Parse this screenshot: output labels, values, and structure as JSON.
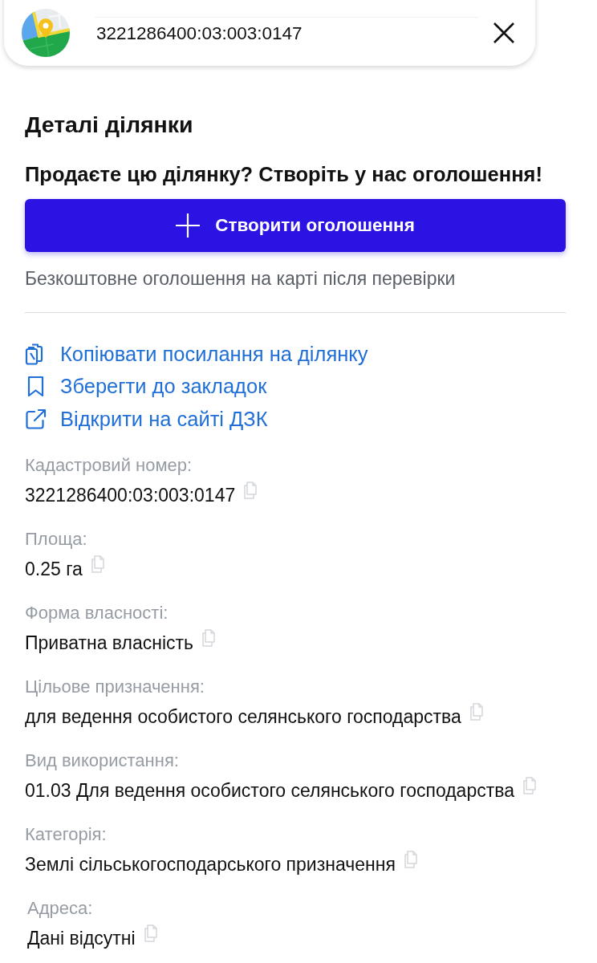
{
  "search": {
    "value": "3221286400:03:003:0147"
  },
  "panel": {
    "title": "Деталі ділянки",
    "promo_text": "Продаєте цю ділянку? Створіть у нас оголошення!",
    "create_button": {
      "label": "Створити оголошення"
    },
    "note": "Безкоштовне оголошення на карті після перевірки"
  },
  "actions": [
    {
      "kind": "copy",
      "label": "Копіювати посилання на ділянку"
    },
    {
      "kind": "bookmark",
      "label": "Зберегти до закладок"
    },
    {
      "kind": "external",
      "label": "Відкрити на сайті ДЗК"
    }
  ],
  "fields": [
    {
      "label": "Кадастровий номер:",
      "value": "3221286400:03:003:0147"
    },
    {
      "label": "Площа:",
      "value": "0.25 га"
    },
    {
      "label": "Форма власності:",
      "value": "Приватна власність"
    },
    {
      "label": "Цільове призначення:",
      "value": "для ведення особистого селянського господарства"
    },
    {
      "label": "Вид використання:",
      "value": "01.03 Для ведення особистого селянського господарства"
    },
    {
      "label": "Категорія:",
      "value": "Землі сільськогосподарського призначення"
    },
    {
      "label": "Адреса:",
      "value": "Дані відсутні"
    }
  ]
}
